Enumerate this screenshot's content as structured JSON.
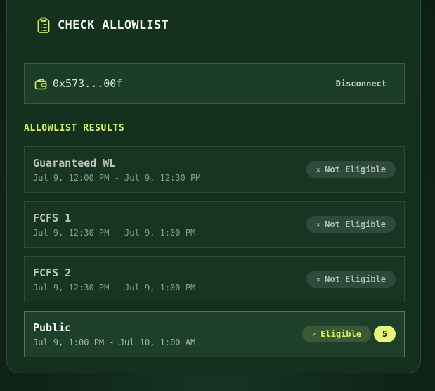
{
  "header": {
    "title": "CHECK ALLOWLIST",
    "icon": "clipboard-list-icon"
  },
  "wallet": {
    "address": "0x573...00f",
    "disconnect_label": "Disconnect",
    "icon": "wallet-icon"
  },
  "results": {
    "label": "ALLOWLIST RESULTS",
    "items": [
      {
        "name": "Guaranteed WL",
        "time": "Jul 9, 12:00 PM - Jul 9, 12:30 PM",
        "status": "Not Eligible",
        "status_icon": "x-icon"
      },
      {
        "name": "FCFS 1",
        "time": "Jul 9, 12:30 PM - Jul 9, 1:00 PM",
        "status": "Not Eligible",
        "status_icon": "x-icon"
      },
      {
        "name": "FCFS 2",
        "time": "Jul 9, 12:30 PM - Jul 9, 1:00 PM",
        "status": "Not Eligible",
        "status_icon": "x-icon"
      },
      {
        "name": "Public",
        "time": "Jul 9, 1:00 PM - Jul 10, 1:00 AM",
        "status": "Eligible",
        "status_icon": "check-icon",
        "count": "5"
      }
    ]
  },
  "colors": {
    "accent": "#d9f25c",
    "count_badge": "#e9f777",
    "background": "#14301f"
  }
}
